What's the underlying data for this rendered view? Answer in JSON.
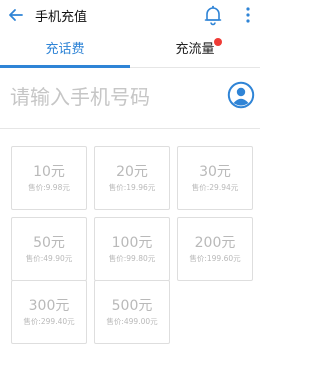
{
  "header": {
    "title": "手机充值",
    "back_icon": "back-arrow-icon",
    "bell_icon": "bell-icon",
    "more_icon": "more-vertical-icon"
  },
  "tabs": [
    {
      "label": "充话费",
      "active": true
    },
    {
      "label": "充流量",
      "active": false,
      "badge": true
    }
  ],
  "phone": {
    "placeholder": "请输入手机号码",
    "value": "",
    "contact_icon": "contact-avatar-icon"
  },
  "options": [
    {
      "amount": "10元",
      "price": "售价:9.98元"
    },
    {
      "amount": "20元",
      "price": "售价:19.96元"
    },
    {
      "amount": "30元",
      "price": "售价:29.94元"
    },
    {
      "amount": "50元",
      "price": "售价:49.90元"
    },
    {
      "amount": "100元",
      "price": "售价:99.80元"
    },
    {
      "amount": "200元",
      "price": "售价:199.60元"
    },
    {
      "amount": "300元",
      "price": "售价:299.40元"
    },
    {
      "amount": "500元",
      "price": "售价:499.00元"
    }
  ],
  "colors": {
    "accent": "#2f84d6",
    "badge": "#ef3b36",
    "border": "#dedede",
    "muted_text": "#b9b9b9"
  }
}
